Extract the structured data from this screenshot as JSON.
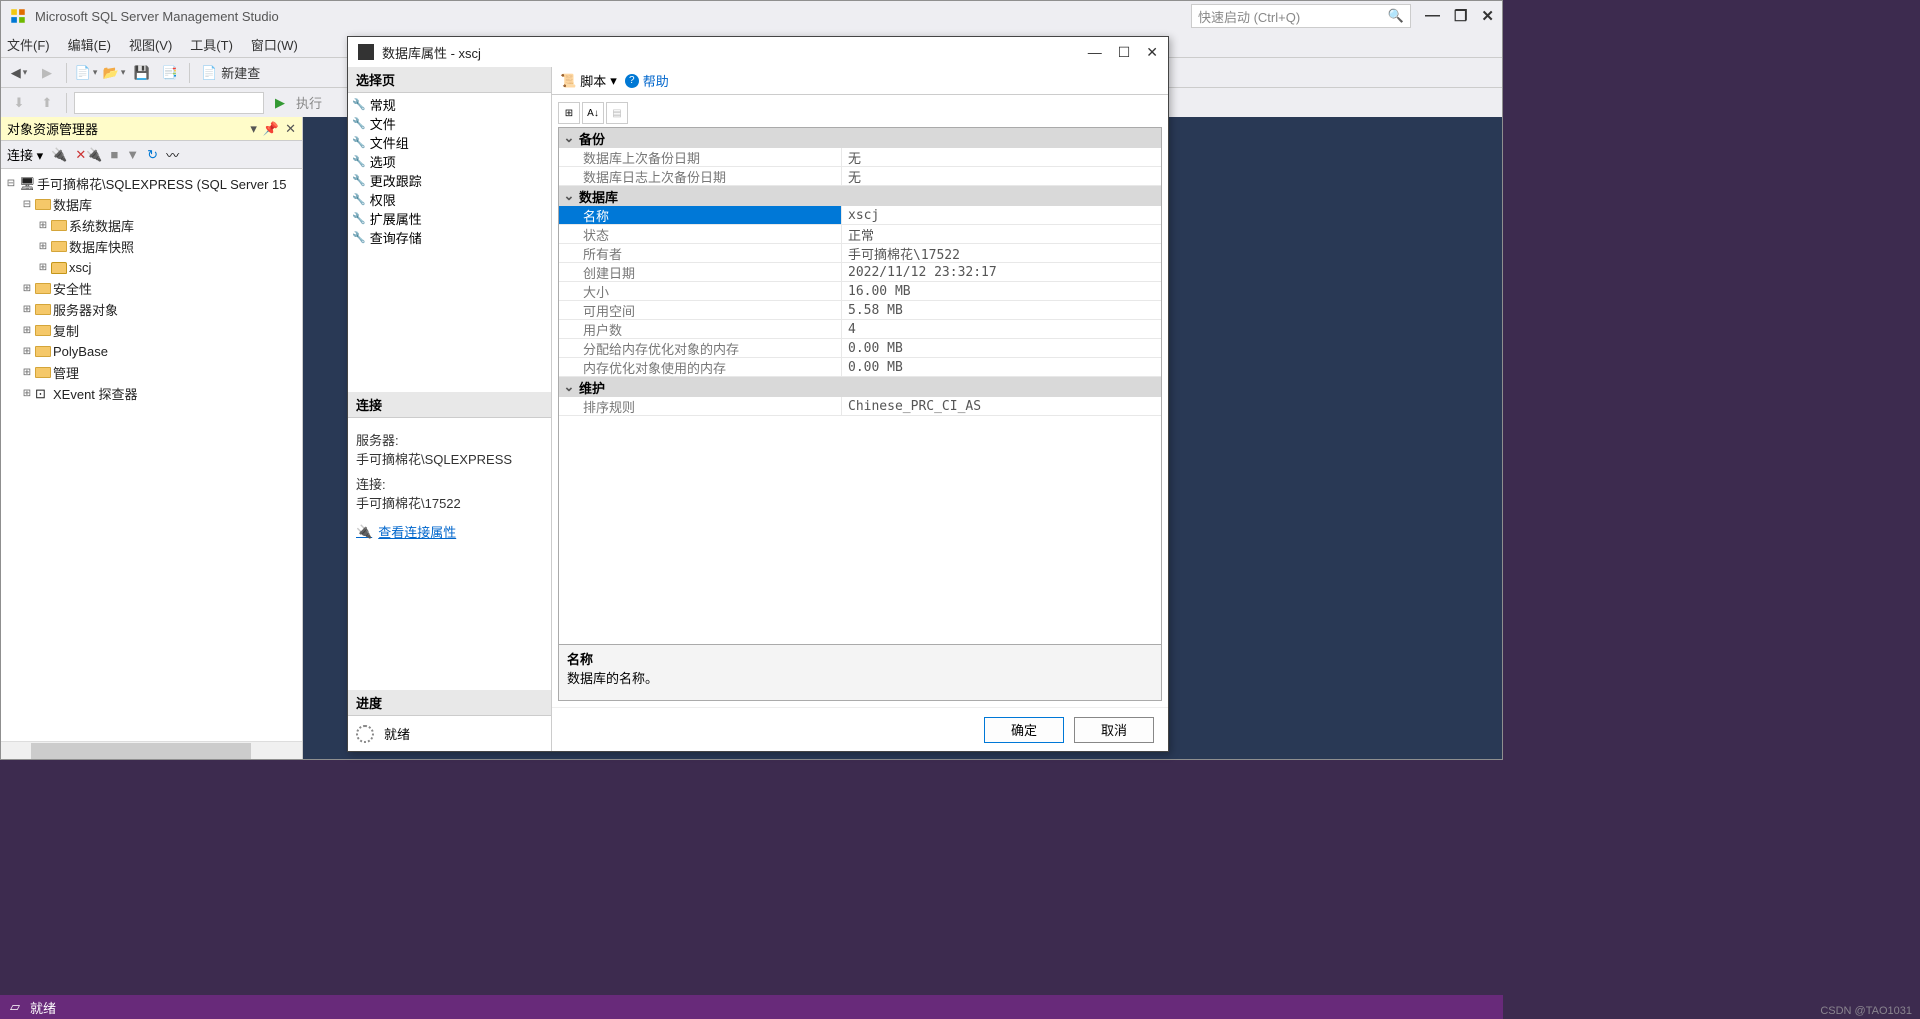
{
  "app": {
    "title": "Microsoft SQL Server Management Studio",
    "quick_launch_placeholder": "快速启动 (Ctrl+Q)"
  },
  "menus": {
    "file": "文件(F)",
    "edit": "编辑(E)",
    "view": "视图(V)",
    "tools": "工具(T)",
    "window": "窗口(W)"
  },
  "toolbar": {
    "new_query": "新建查",
    "execute": "执行"
  },
  "object_explorer": {
    "title": "对象资源管理器",
    "connect": "连接",
    "root": "手可摘棉花\\SQLEXPRESS (SQL Server 15",
    "nodes": {
      "databases": "数据库",
      "system_databases": "系统数据库",
      "database_snapshots": "数据库快照",
      "xscj": "xscj",
      "security": "安全性",
      "server_objects": "服务器对象",
      "replication": "复制",
      "polybase": "PolyBase",
      "management": "管理",
      "xevent": "XEvent 探查器"
    }
  },
  "dialog": {
    "title": "数据库属性 - xscj",
    "select_page": "选择页",
    "pages": {
      "general": "常规",
      "files": "文件",
      "filegroups": "文件组",
      "options": "选项",
      "change_tracking": "更改跟踪",
      "permissions": "权限",
      "extended_properties": "扩展属性",
      "query_store": "查询存储"
    },
    "script": "脚本",
    "help": "帮助",
    "connection_header": "连接",
    "server_label": "服务器:",
    "server_value": "手可摘棉花\\SQLEXPRESS",
    "connection_label": "连接:",
    "connection_value": "手可摘棉花\\17522",
    "view_connection": "查看连接属性",
    "progress_header": "进度",
    "progress_status": "就绪",
    "groups": {
      "backup": "备份",
      "database": "数据库",
      "maintenance": "维护"
    },
    "props": {
      "last_backup": {
        "k": "数据库上次备份日期",
        "v": "无"
      },
      "last_log_backup": {
        "k": "数据库日志上次备份日期",
        "v": "无"
      },
      "name": {
        "k": "名称",
        "v": "xscj"
      },
      "status": {
        "k": "状态",
        "v": "正常"
      },
      "owner": {
        "k": "所有者",
        "v": "手可摘棉花\\17522"
      },
      "created": {
        "k": "创建日期",
        "v": "2022/11/12 23:32:17"
      },
      "size": {
        "k": "大小",
        "v": "16.00 MB"
      },
      "available": {
        "k": "可用空间",
        "v": "5.58 MB"
      },
      "users": {
        "k": "用户数",
        "v": "4"
      },
      "mem_alloc": {
        "k": "分配给内存优化对象的内存",
        "v": "0.00 MB"
      },
      "mem_used": {
        "k": "内存优化对象使用的内存",
        "v": "0.00 MB"
      },
      "collation": {
        "k": "排序规则",
        "v": "Chinese_PRC_CI_AS"
      }
    },
    "desc_name": "名称",
    "desc_text": "数据库的名称。",
    "ok": "确定",
    "cancel": "取消"
  },
  "status": {
    "ready": "就绪"
  },
  "watermark": "CSDN @TAO1031"
}
